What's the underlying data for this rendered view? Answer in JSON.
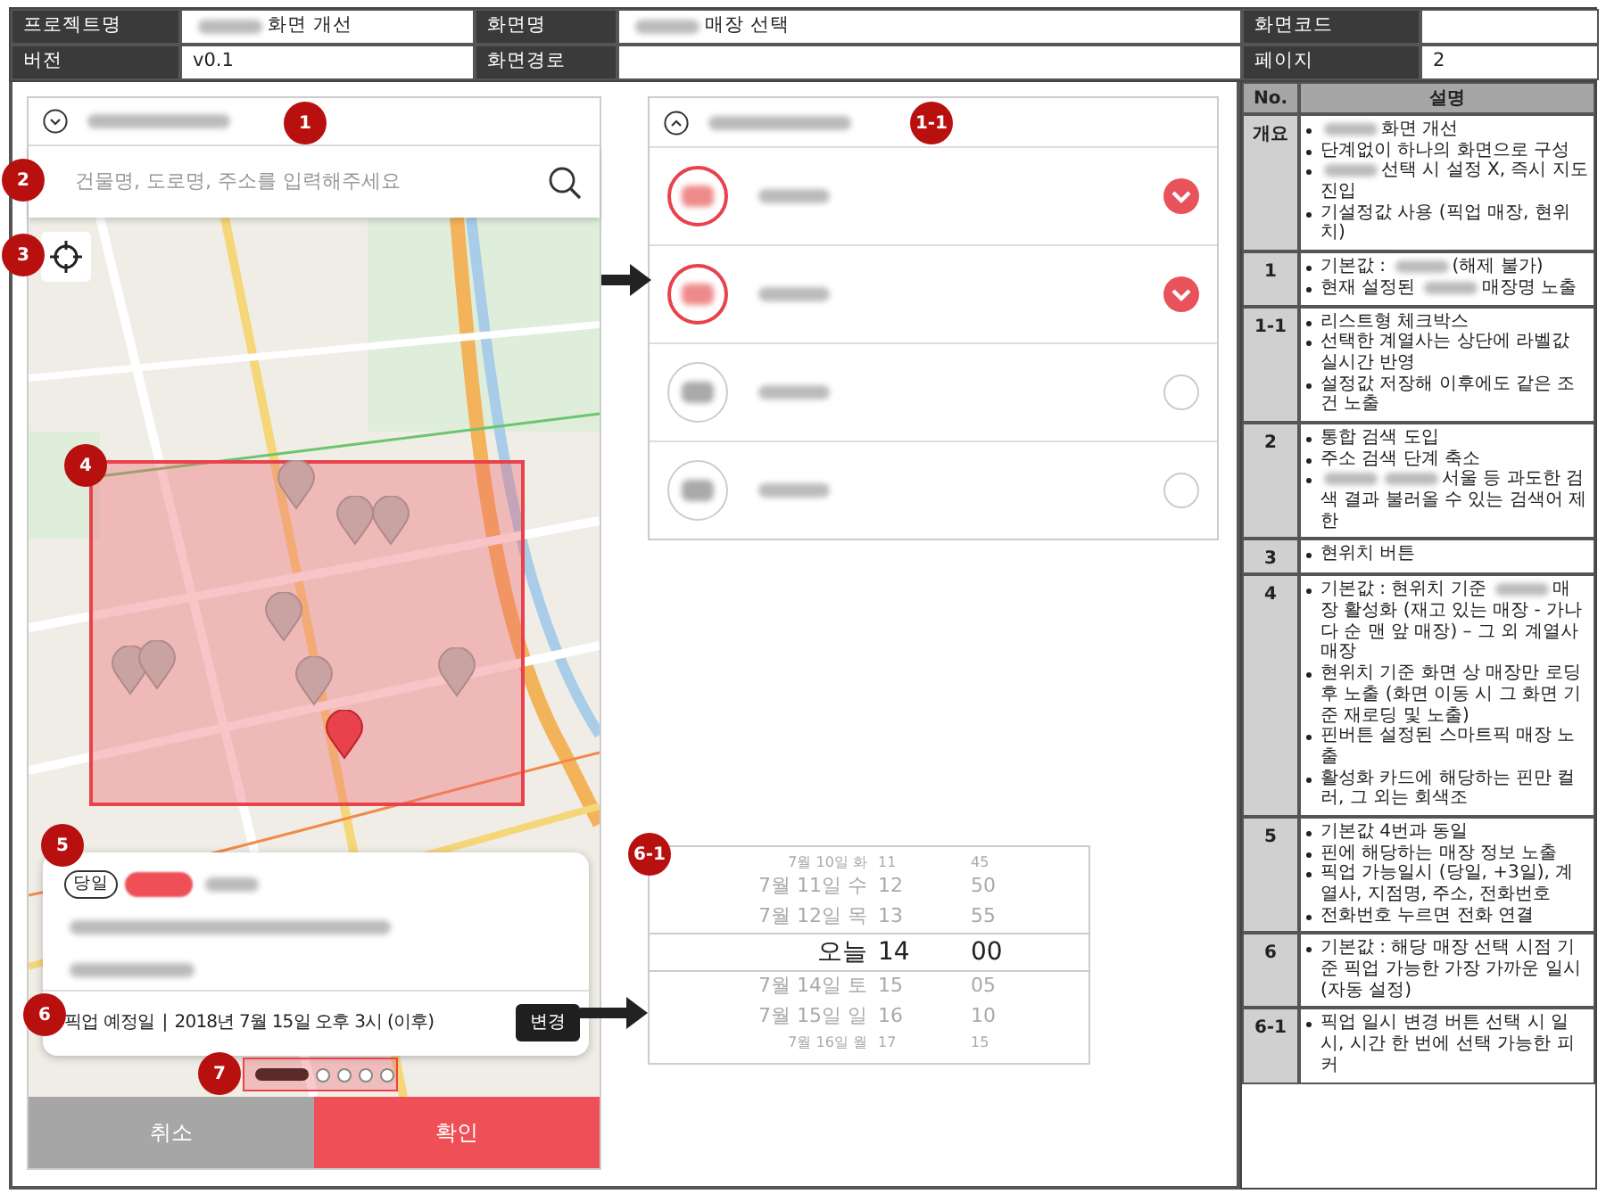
{
  "header": {
    "rows": [
      [
        {
          "label": "프로젝트명",
          "value": "화면 개선",
          "redacted": true
        },
        {
          "label": "화면명",
          "value": "매장 선택",
          "redacted": true
        },
        {
          "label": "화면코드"
        }
      ],
      [
        {
          "label": "버전",
          "value": "v0.1",
          "redacted": false
        },
        {
          "label": "화면경로"
        },
        {
          "label": "페이지",
          "value": "2",
          "redacted": false
        }
      ]
    ]
  },
  "phone": {
    "store_dropdown": {
      "marker": "1",
      "expanded": false
    },
    "search": {
      "marker": "2",
      "placeholder": "건물명, 도로명, 주소를 입력해주세요"
    },
    "locate_button": {
      "marker": "3"
    },
    "map": {
      "marker": "4",
      "pins": [
        {
          "active": false
        },
        {
          "active": false
        },
        {
          "active": false
        },
        {
          "active": false
        },
        {
          "active": false
        },
        {
          "active": false
        },
        {
          "active": false
        },
        {
          "active": false
        },
        {
          "active": true
        }
      ]
    },
    "store_card": {
      "marker": "5",
      "badge": "당일",
      "pickup": {
        "marker": "6",
        "label": "픽업 예정일",
        "separator": "|",
        "date": "2018년 7월 15일 오후 3시 (이후)",
        "button": "변경"
      }
    },
    "pager": {
      "marker": "7",
      "dots": [
        {
          "selected": true
        },
        {
          "selected": false
        },
        {
          "selected": false
        },
        {
          "selected": false
        },
        {
          "selected": false
        }
      ]
    },
    "buttons": [
      {
        "kind": "cancel",
        "label": "취소"
      },
      {
        "kind": "confirm",
        "label": "확인"
      }
    ]
  },
  "brand_list": {
    "marker": "1-1",
    "expanded": true,
    "items": [
      {
        "checked": true
      },
      {
        "checked": true
      },
      {
        "checked": false
      },
      {
        "checked": false
      }
    ]
  },
  "picker": {
    "marker": "6-1",
    "rows": [
      {
        "date": "7월 10일 화",
        "hour": "11",
        "minute": "45",
        "selected": false
      },
      {
        "date": "7월 11일 수",
        "hour": "12",
        "minute": "50",
        "selected": false
      },
      {
        "date": "7월 12일 목",
        "hour": "13",
        "minute": "55",
        "selected": false
      },
      {
        "date": "오늘",
        "hour": "14",
        "minute": "00",
        "selected": true
      },
      {
        "date": "7월 14일 토",
        "hour": "15",
        "minute": "05",
        "selected": false
      },
      {
        "date": "7월 15일 일",
        "hour": "16",
        "minute": "10",
        "selected": false
      },
      {
        "date": "7월 16일 월",
        "hour": "17",
        "minute": "15",
        "selected": false
      }
    ]
  },
  "description_table": {
    "columns": [
      "No.",
      "설명"
    ],
    "rows": [
      {
        "no": "개요",
        "bullets": [
          [
            {
              "kind": "blur"
            },
            {
              "kind": "text",
              "text": "화면 개선"
            }
          ],
          [
            {
              "kind": "text",
              "text": "단계없이 하나의 화면으로 구성"
            }
          ],
          [
            {
              "kind": "blur"
            },
            {
              "kind": "text",
              "text": "선택 시 설정 X, 즉시 지도 진입"
            }
          ],
          [
            {
              "kind": "text",
              "text": "기설정값 사용 (픽업 매장, 현위치)"
            }
          ]
        ]
      },
      {
        "no": "1",
        "bullets": [
          [
            {
              "kind": "text",
              "text": "기본값 :"
            },
            {
              "kind": "blur"
            },
            {
              "kind": "text",
              "text": "(해제 불가)"
            }
          ],
          [
            {
              "kind": "text",
              "text": "현재 설정된"
            },
            {
              "kind": "blur"
            },
            {
              "kind": "text",
              "text": "매장명 노출"
            }
          ]
        ]
      },
      {
        "no": "1-1",
        "bullets": [
          [
            {
              "kind": "text",
              "text": "리스트형 체크박스"
            }
          ],
          [
            {
              "kind": "text",
              "text": "선택한 계열사는 상단에 라벨값 실시간 반영"
            }
          ],
          [
            {
              "kind": "text",
              "text": "설정값 저장해 이후에도 같은 조건 노출"
            }
          ]
        ]
      },
      {
        "no": "2",
        "bullets": [
          [
            {
              "kind": "text",
              "text": "통합 검색 도입"
            }
          ],
          [
            {
              "kind": "text",
              "text": "주소 검색 단계 축소"
            }
          ],
          [
            {
              "kind": "blur"
            },
            {
              "kind": "blur"
            },
            {
              "kind": "text",
              "text": "서울 등 과도한 검색 결과 불러올 수 있는 검색어 제한"
            }
          ]
        ]
      },
      {
        "no": "3",
        "bullets": [
          [
            {
              "kind": "text",
              "text": "현위치 버튼"
            }
          ]
        ]
      },
      {
        "no": "4",
        "bullets": [
          [
            {
              "kind": "text",
              "text": "기본값 : 현위치 기준"
            },
            {
              "kind": "blur"
            },
            {
              "kind": "text",
              "text": "매장 활성화 (재고 있는 매장 - 가나다 순 맨 앞 매장) – 그 외 계열사 매장"
            }
          ],
          [
            {
              "kind": "text",
              "text": "현위치 기준 화면 상 매장만 로딩 후 노출 (화면 이동 시 그 화면 기준 재로딩 및 노출)"
            }
          ],
          [
            {
              "kind": "text",
              "text": "핀버튼 설정된 스마트픽 매장 노출"
            }
          ],
          [
            {
              "kind": "text",
              "text": "활성화 카드에 해당하는 핀만 컬러, 그 외는 회색조"
            }
          ]
        ]
      },
      {
        "no": "5",
        "bullets": [
          [
            {
              "kind": "text",
              "text": "기본값 4번과 동일"
            }
          ],
          [
            {
              "kind": "text",
              "text": "핀에 해당하는 매장 정보 노출"
            }
          ],
          [
            {
              "kind": "text",
              "text": "픽업 가능일시 (당일, +3일), 계열사, 지점명, 주소, 전화번호"
            }
          ],
          [
            {
              "kind": "text",
              "text": "전화번호 누르면 전화 연결"
            }
          ]
        ]
      },
      {
        "no": "6",
        "bullets": [
          [
            {
              "kind": "text",
              "text": "기본값 : 해당 매장 선택 시점 기준 픽업 가능한 가장 가까운 일시 (자동 설정)"
            }
          ]
        ]
      },
      {
        "no": "6-1",
        "bullets": [
          [
            {
              "kind": "text",
              "text": "픽업 일시 변경 버튼 선택 시 일시, 시간 한 번에 선택 가능한 피커"
            }
          ]
        ]
      }
    ]
  }
}
